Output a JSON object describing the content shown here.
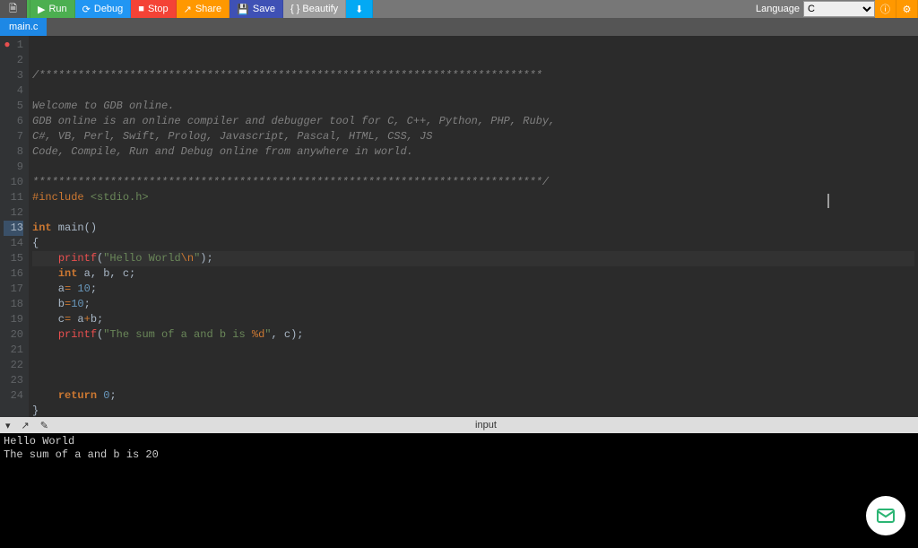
{
  "toolbar": {
    "run": "Run",
    "debug": "Debug",
    "stop": "Stop",
    "share": "Share",
    "save": "Save",
    "beautify": "{ } Beautify",
    "language_label": "Language",
    "language_value": "C"
  },
  "tabs": {
    "active": "main.c"
  },
  "editor": {
    "lines": [
      {
        "n": 1,
        "bp": true,
        "html": "<span class='cmt'>/******************************************************************************</span>"
      },
      {
        "n": 2,
        "html": ""
      },
      {
        "n": 3,
        "html": "<span class='cmt'>Welcome to GDB online.</span>"
      },
      {
        "n": 4,
        "html": "<span class='cmt'>GDB online is an online compiler and debugger tool for C, C++, Python, PHP, Ruby, </span>"
      },
      {
        "n": 5,
        "html": "<span class='cmt'>C#, VB, Perl, Swift, Prolog, Javascript, Pascal, HTML, CSS, JS</span>"
      },
      {
        "n": 6,
        "html": "<span class='cmt'>Code, Compile, Run and Debug online from anywhere in world.</span>"
      },
      {
        "n": 7,
        "html": ""
      },
      {
        "n": 8,
        "html": "<span class='cmt'>*******************************************************************************/</span>"
      },
      {
        "n": 9,
        "html": "<span class='pp'>#include</span> <span class='inc'>&lt;stdio.h&gt;</span>"
      },
      {
        "n": 10,
        "html": ""
      },
      {
        "n": 11,
        "html": "<span class='kw'>int</span> main()"
      },
      {
        "n": 12,
        "html": "{"
      },
      {
        "n": 13,
        "hl": true,
        "html": "    <span class='fn'>printf</span>(<span class='str'>\"Hello World<span class='esc'>\\n</span>\"</span>);"
      },
      {
        "n": 14,
        "html": "    <span class='kw'>int</span> a, b, c;"
      },
      {
        "n": 15,
        "html": "    a<span class='op'>=</span> <span class='num'>10</span>;"
      },
      {
        "n": 16,
        "html": "    b<span class='op'>=</span><span class='num'>10</span>;"
      },
      {
        "n": 17,
        "html": "    c<span class='op'>=</span> a<span class='op'>+</span>b;"
      },
      {
        "n": 18,
        "html": "    <span class='fn'>printf</span>(<span class='str'>\"The sum of a and b is <span class='esc'>%d</span>\"</span>, c);"
      },
      {
        "n": 19,
        "html": "    "
      },
      {
        "n": 20,
        "html": ""
      },
      {
        "n": 21,
        "html": ""
      },
      {
        "n": 22,
        "html": "    <span class='kw'>return</span> <span class='num'>0</span>;"
      },
      {
        "n": 23,
        "html": "}"
      },
      {
        "n": 24,
        "html": ""
      }
    ]
  },
  "panel": {
    "title": "input"
  },
  "console": {
    "lines": [
      "Hello World",
      "The sum of a and b is 20"
    ]
  }
}
